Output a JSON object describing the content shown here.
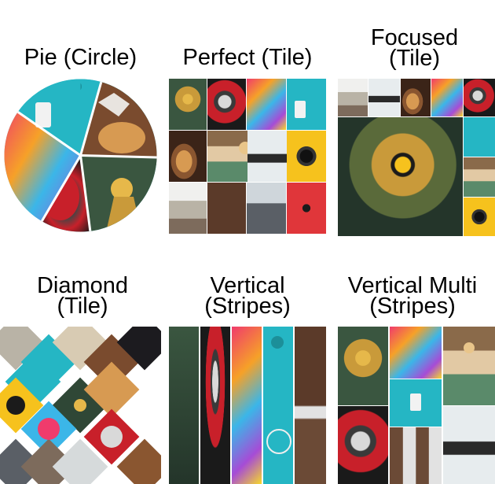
{
  "layouts": [
    {
      "id": "pie",
      "title": "Pie (Circle)"
    },
    {
      "id": "perfect",
      "title": "Perfect (Tile)"
    },
    {
      "id": "focused",
      "title": "Focused\n(Tile)"
    },
    {
      "id": "diamond",
      "title": "Diamond\n(Tile)"
    },
    {
      "id": "vertical",
      "title": "Vertical\n(Stripes)"
    },
    {
      "id": "vertical-multi",
      "title": "Vertical Multi\n(Stripes)"
    }
  ]
}
